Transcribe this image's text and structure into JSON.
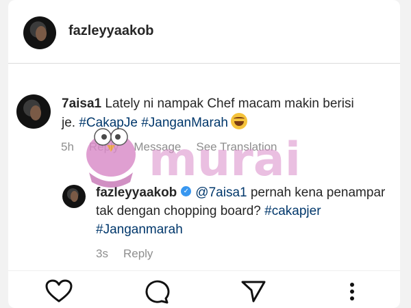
{
  "post": {
    "author": "fazleyyaakob"
  },
  "comment": {
    "username": "7aisa1",
    "text_before": "Lately ni nampak Chef macam makin berisi je.",
    "hashtags": [
      "#CakapJe",
      "#JanganMarah"
    ],
    "emoji": "laughing-crying-emoji",
    "time": "5h",
    "actions": [
      "Reply",
      "Message",
      "See Translation"
    ]
  },
  "reply": {
    "username": "fazleyyaakob",
    "verified": true,
    "mention": "@7aisa1",
    "text": "pernah kena penampar tak dengan chopping board?",
    "hashtags": [
      "#cakapjer",
      "#Janganmarah"
    ],
    "time": "3s",
    "reply_label": "Reply"
  },
  "watermark": {
    "text": "murai",
    "color": "#d98ac8"
  },
  "colors": {
    "hashtag": "#00376b",
    "meta": "#8e8e8e",
    "verified": "#3897f0"
  }
}
